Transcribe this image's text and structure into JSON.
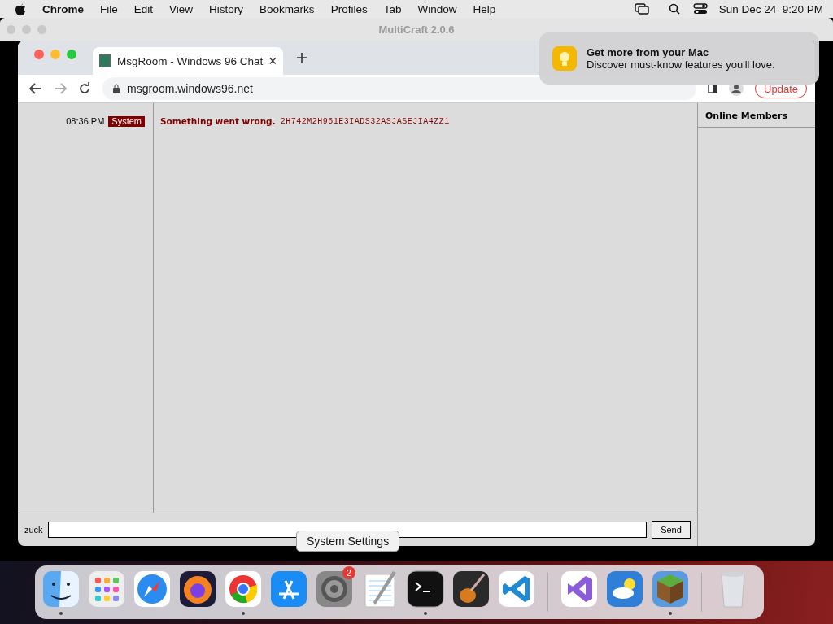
{
  "menubar": {
    "app": "Chrome",
    "menus": [
      "File",
      "Edit",
      "View",
      "History",
      "Bookmarks",
      "Profiles",
      "Tab",
      "Window",
      "Help"
    ],
    "clock": "Sun Dec 24  9:20 PM"
  },
  "back_window": {
    "title": "MultiCraft 2.0.6"
  },
  "browser": {
    "tabs": [
      {
        "title": "MsgRoom - Windows 96 Chat",
        "selected": true
      }
    ],
    "url": "msgroom.windows96.net",
    "update_label": "Update"
  },
  "chat": {
    "messages": [
      {
        "time": "08:36 PM",
        "author": "System",
        "lead": "Something went wrong.",
        "code": "2H742M2H961E3IADS32ASJASEJIA4ZZ1"
      }
    ],
    "members_title": "Online Members",
    "nickname": "zuck",
    "send_label": "Send"
  },
  "notification": {
    "title": "Get more from your Mac",
    "body": "Discover must-know features you'll love."
  },
  "tooltip": "System Settings",
  "dock": [
    {
      "kind": "finder",
      "running": true
    },
    {
      "kind": "launchpad",
      "running": false
    },
    {
      "kind": "safari",
      "running": false
    },
    {
      "kind": "firefox",
      "running": false
    },
    {
      "kind": "chrome",
      "running": true
    },
    {
      "kind": "appstore",
      "running": false
    },
    {
      "kind": "settings",
      "running": false,
      "badge": "2"
    },
    {
      "kind": "textedit",
      "running": false
    },
    {
      "kind": "terminal",
      "running": true
    },
    {
      "kind": "guitar",
      "running": false
    },
    {
      "kind": "vscode",
      "running": false
    },
    {
      "kind": "separator"
    },
    {
      "kind": "visualstudio",
      "running": false
    },
    {
      "kind": "weather",
      "running": false
    },
    {
      "kind": "minecraft",
      "running": true
    },
    {
      "kind": "separator"
    },
    {
      "kind": "trash",
      "running": false
    }
  ]
}
